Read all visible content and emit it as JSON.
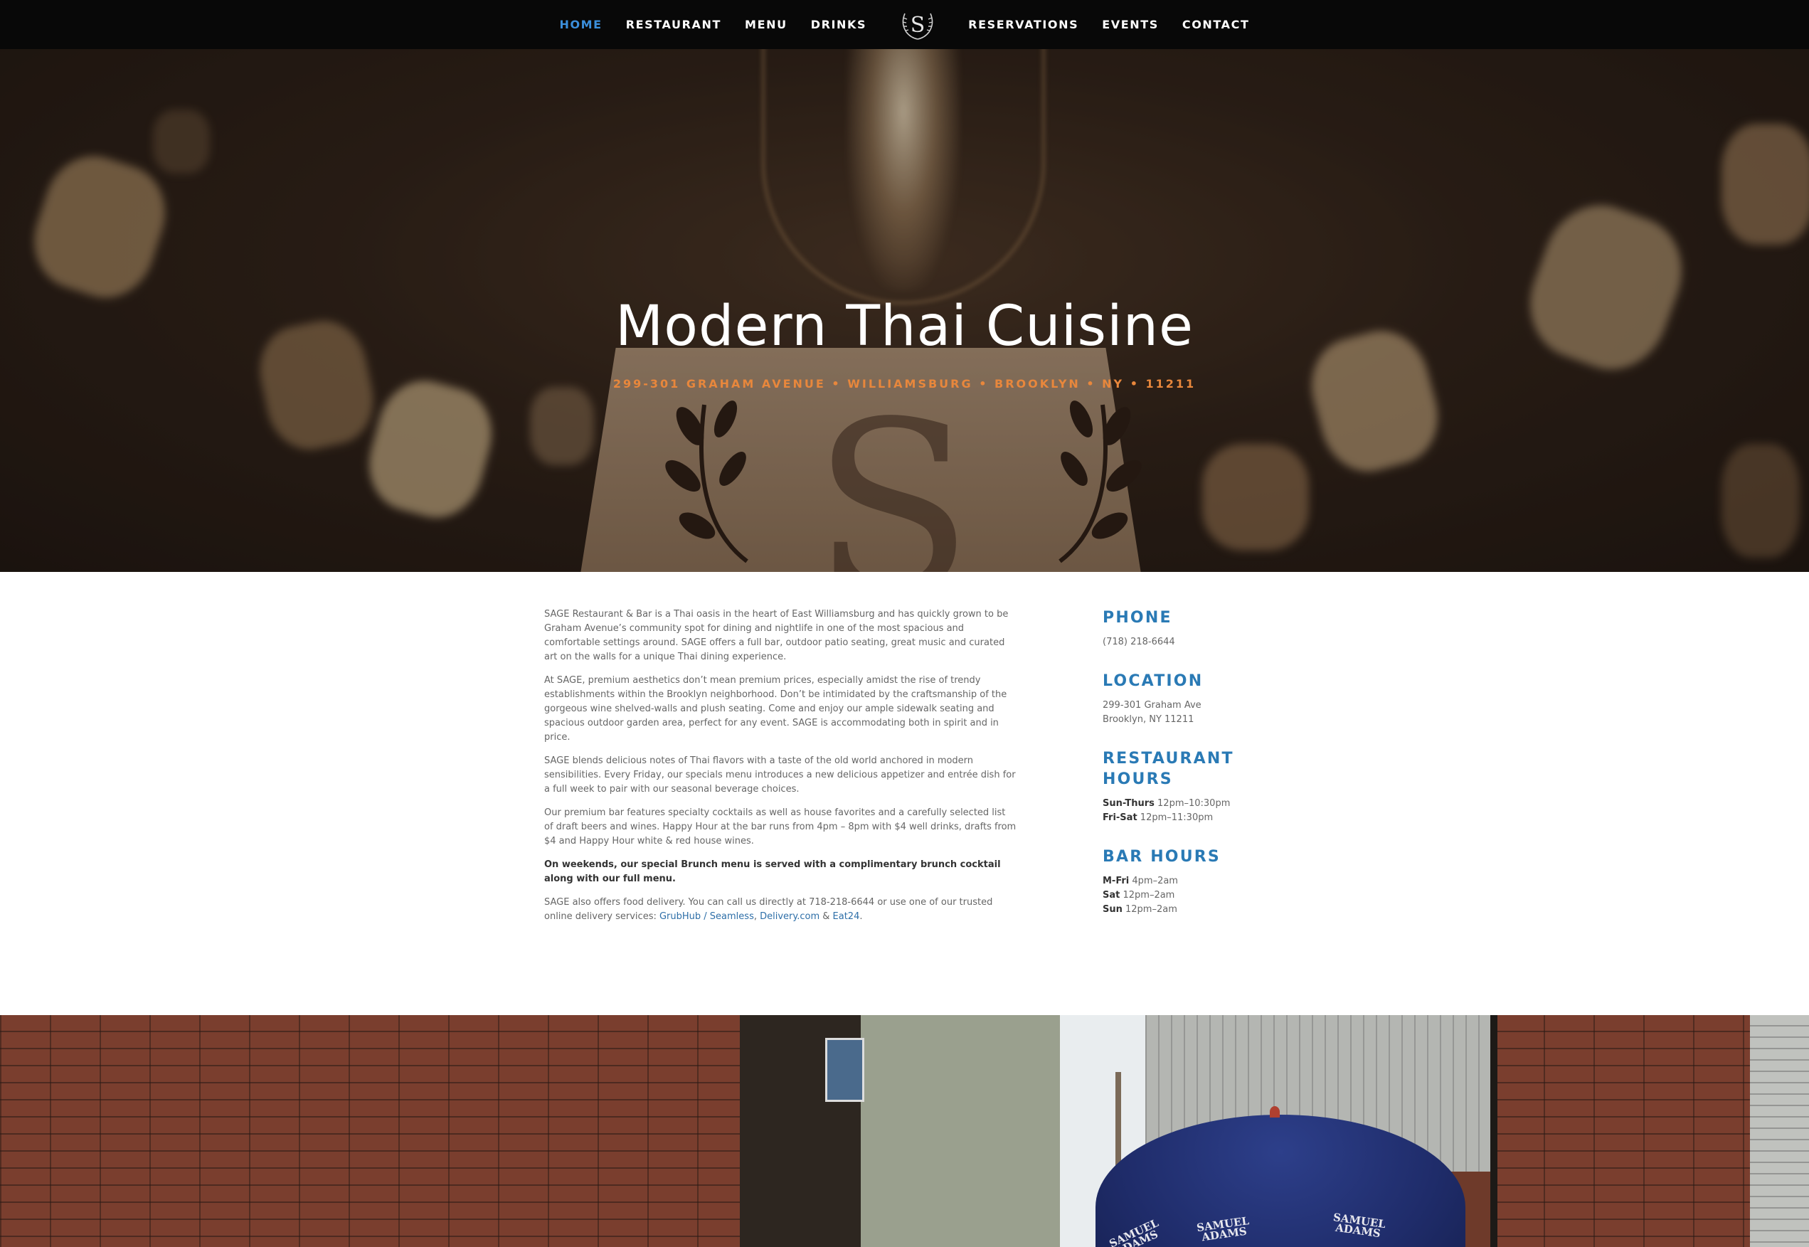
{
  "nav": {
    "left_items": [
      {
        "label": "HOME",
        "active": true
      },
      {
        "label": "RESTAURANT",
        "active": false
      },
      {
        "label": "MENU",
        "active": false
      },
      {
        "label": "DRINKS",
        "active": false
      }
    ],
    "right_items": [
      {
        "label": "RESERVATIONS",
        "active": false
      },
      {
        "label": "EVENTS",
        "active": false
      },
      {
        "label": "CONTACT",
        "active": false
      }
    ],
    "logo_letter": "S",
    "active_color": "#3b8fdc"
  },
  "hero": {
    "title": "Modern Thai Cuisine",
    "address": "299-301 GRAHAM AVENUE • WILLIAMSBURG • BROOKLYN • NY • 11211",
    "card_letter": "S",
    "address_color": "#e8873c"
  },
  "about": {
    "p1": "SAGE Restaurant & Bar is a Thai oasis in the heart of East Williamsburg and has quickly grown to be Graham Avenue’s community spot for dining and nightlife in one of the most spacious and comfortable settings around. SAGE offers a full bar, outdoor patio seating, great music and curated art on the walls for a unique Thai dining experience.",
    "p2": "At SAGE, premium aesthetics don’t mean premium prices, especially amidst the rise of trendy establishments within the Brooklyn neighborhood. Don’t be intimidated by the craftsmanship of the gorgeous wine shelved-walls and plush seating. Come and enjoy our ample sidewalk seating and spacious outdoor garden area, perfect for any event. SAGE is accommodating both in spirit and in price.",
    "p3": "SAGE blends delicious notes of Thai flavors with a taste of the old world anchored in modern sensibilities. Every Friday, our specials menu introduces a new delicious appetizer and entrée dish for a full week to pair with our seasonal beverage choices.",
    "p4": "Our premium bar features specialty cocktails as well as house favorites and a carefully selected list of draft beers and wines. Happy Hour at the bar runs from 4pm – 8pm with $4 well drinks, drafts from $4 and Happy Hour white & red house wines.",
    "p5": "On weekends, our special Brunch menu is served with a complimentary brunch cocktail along with our full menu.",
    "p6_text": "SAGE also offers food delivery.  You can call us directly at 718-218-6644 or use one of our trusted online delivery services: ",
    "link_grubhub": "GrubHub / Seamless",
    "sep1": ", ",
    "link_delivery": "Delivery.com",
    "sep2": " & ",
    "link_eat24": "Eat24",
    "end": ".",
    "link_color": "#2e6fa8"
  },
  "info": {
    "phone_heading": "PHONE",
    "phone": "(718) 218-6644",
    "location_heading": "LOCATION",
    "location_line1": "299-301 Graham Ave",
    "location_line2": "Brooklyn, NY 11211",
    "restaurant_hours_heading_1": "RESTAURANT",
    "restaurant_hours_heading_2": "HOURS",
    "rh1_day": "Sun-Thurs",
    "rh1_time": " 12pm–10:30pm",
    "rh2_day": "Fri-Sat",
    "rh2_time": " 12pm–11:30pm",
    "bar_hours_heading": "BAR HOURS",
    "bh1_day": "M-Fri",
    "bh1_time": " 4pm–2am",
    "bh2_day": "Sat",
    "bh2_time": " 12pm–2am",
    "bh3_day": "Sun",
    "bh3_time": " 12pm–2am",
    "heading_color": "#2a7ab5"
  },
  "photo": {
    "umbrella_text_1": "SAMUEL ADAMS",
    "umbrella_text_2": "SAMUEL ADAMS",
    "umbrella_text_3": "SAMUEL ADAMS"
  }
}
